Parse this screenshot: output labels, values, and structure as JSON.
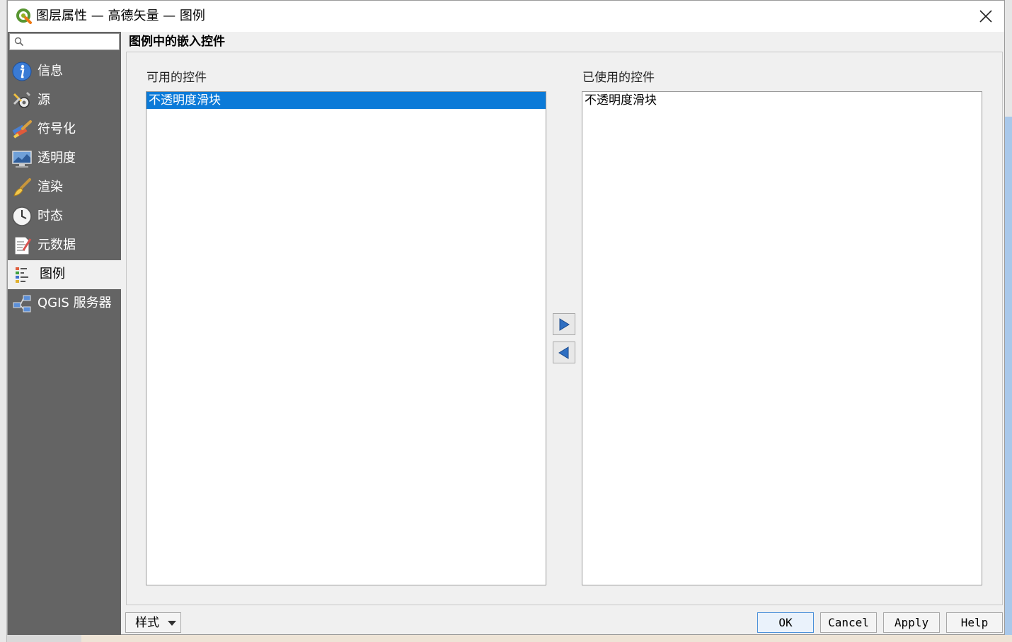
{
  "window": {
    "title": "图层属性 — 高德矢量 — 图例"
  },
  "sidebar": {
    "search_placeholder": "",
    "items": [
      {
        "label": "信息",
        "icon": "info-icon",
        "active": false
      },
      {
        "label": "源",
        "icon": "source-tools-icon",
        "active": false
      },
      {
        "label": "符号化",
        "icon": "symbology-brush-icon",
        "active": false
      },
      {
        "label": "透明度",
        "icon": "transparency-monitor-icon",
        "active": false
      },
      {
        "label": "渲染",
        "icon": "rendering-brush-icon",
        "active": false
      },
      {
        "label": "时态",
        "icon": "temporal-clock-icon",
        "active": false
      },
      {
        "label": "元数据",
        "icon": "metadata-document-icon",
        "active": false
      },
      {
        "label": "图例",
        "icon": "legend-icon",
        "active": true
      },
      {
        "label": "QGIS 服务器",
        "icon": "qgis-server-icon",
        "active": false
      }
    ]
  },
  "legend_page": {
    "section_title": "图例中的嵌入控件",
    "available": {
      "caption": "可用的控件",
      "items": [
        "不透明度滑块"
      ],
      "selected_index": 0
    },
    "used": {
      "caption": "已使用的控件",
      "items": [
        "不透明度滑块"
      ]
    }
  },
  "footer": {
    "style_label": "样式",
    "ok_label": "OK",
    "cancel_label": "Cancel",
    "apply_label": "Apply",
    "help_label": "Help"
  },
  "colors": {
    "sidebar_bg": "#646464",
    "selection": "#0b7ad8",
    "arrow_blue": "#2f6fc2"
  }
}
